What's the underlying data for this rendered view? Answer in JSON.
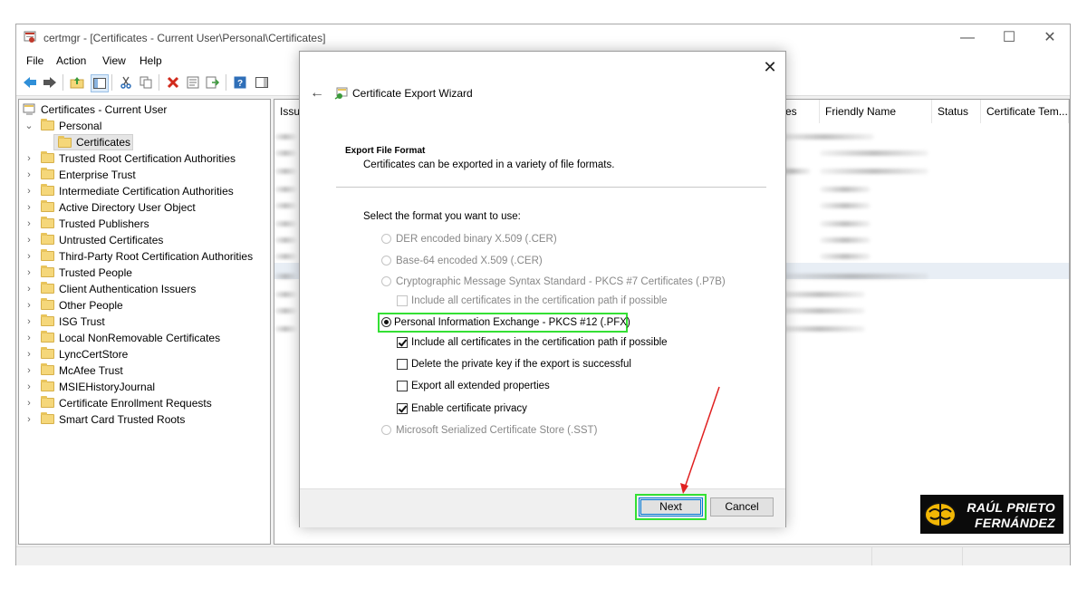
{
  "window": {
    "title": "certmgr - [Certificates - Current User\\Personal\\Certificates]",
    "min_glyph": "—",
    "max_glyph": "☐",
    "close_glyph": "✕"
  },
  "menu": {
    "items": [
      "File",
      "Action",
      "View",
      "Help"
    ]
  },
  "toolbar": {
    "icons": [
      "back-arrow-icon",
      "forward-arrow-icon",
      "up-folder-icon",
      "show-hide-tree-icon",
      "cut-icon",
      "copy-icon",
      "delete-icon",
      "properties-icon",
      "export-list-icon",
      "help-icon",
      "show-pane-icon"
    ]
  },
  "tree": {
    "root": "Certificates - Current User",
    "personal": "Personal",
    "certificates": "Certificates",
    "items": [
      "Trusted Root Certification Authorities",
      "Enterprise Trust",
      "Intermediate Certification Authorities",
      "Active Directory User Object",
      "Trusted Publishers",
      "Untrusted Certificates",
      "Third-Party Root Certification Authorities",
      "Trusted People",
      "Client Authentication Issuers",
      "Other People",
      "ISG Trust",
      "Local NonRemovable Certificates",
      "LyncCertStore",
      "McAfee Trust",
      "MSIEHistoryJournal",
      "Certificate Enrollment Requests",
      "Smart Card Trusted Roots"
    ]
  },
  "list": {
    "columns": [
      "Issu",
      "ses",
      "Friendly Name",
      "Status",
      "Certificate Tem..."
    ]
  },
  "wizard": {
    "title": "Certificate Export Wizard",
    "close_glyph": "✕",
    "back_glyph": "←",
    "section_title": "Export File Format",
    "section_desc": "Certificates can be exported in a variety of file formats.",
    "prompt": "Select the format you want to use:",
    "options": {
      "der": "DER encoded binary X.509 (.CER)",
      "base64": "Base-64 encoded X.509 (.CER)",
      "pkcs7": "Cryptographic Message Syntax Standard - PKCS #7 Certificates (.P7B)",
      "pkcs7_include": "Include all certificates in the certification path if possible",
      "pfx": "Personal Information Exchange - PKCS #12 (.PFX)",
      "pfx_include": "Include all certificates in the certification path if possible",
      "pfx_delete_key": "Delete the private key if the export is successful",
      "pfx_export_ext": "Export all extended properties",
      "pfx_privacy": "Enable certificate privacy",
      "sst": "Microsoft Serialized Certificate Store (.SST)"
    },
    "next_label": "Next",
    "cancel_label": "Cancel"
  },
  "brand": {
    "line1": "RAÚL PRIETO",
    "line2": "FERNÁNDEZ"
  },
  "colors": {
    "highlight": "#34e034",
    "annotation_arrow": "#e02020",
    "focus_blue": "#0078d7"
  }
}
